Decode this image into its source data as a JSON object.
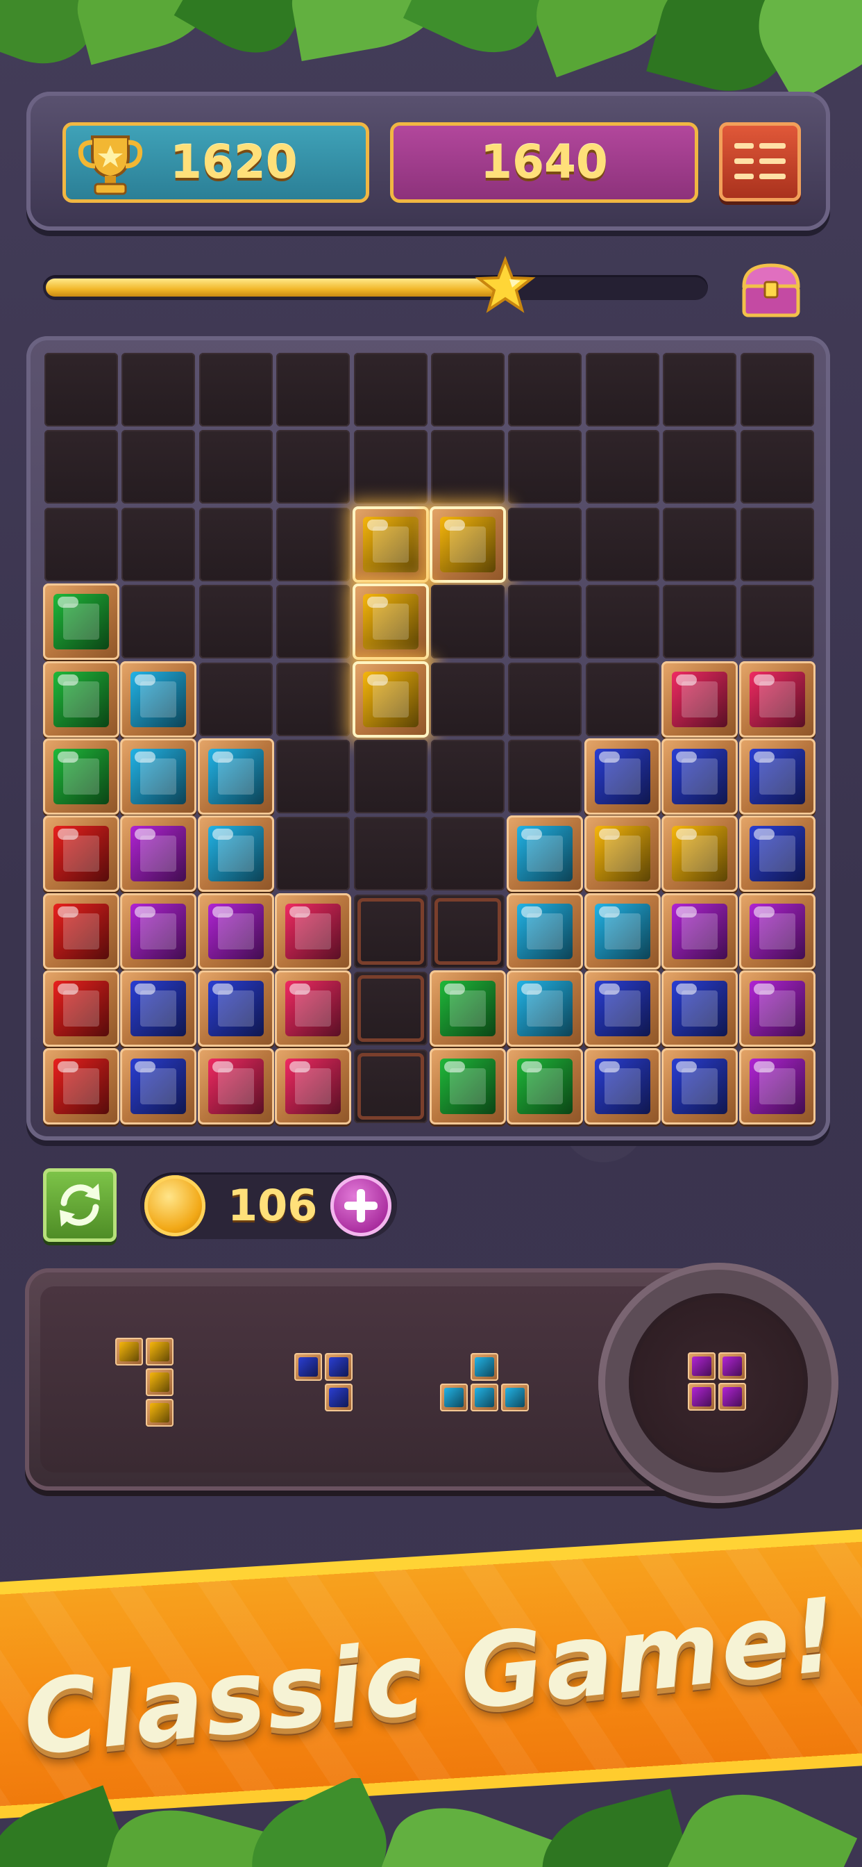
{
  "header": {
    "best_score": "1620",
    "current_score": "1640",
    "best_icon": "trophy-icon",
    "menu_icon": "menu-icon"
  },
  "progress": {
    "fraction": 0.7,
    "marker_icon": "star-icon",
    "reward_icon": "treasure-chest-icon"
  },
  "board": {
    "columns": 10,
    "rows": 10,
    "colors": {
      "G": "#1fb83a",
      "C": "#22b3e6",
      "Y": "#f6b60c",
      "R": "#e8201d",
      "P": "#b024d4",
      "B": "#2a3ed2",
      "K": "#ef2a62"
    },
    "cells": [
      "..........",
      "..........",
      "....yy....",
      "G...y.....",
      "GC..y...KK",
      "GCC....BBB",
      "RPC...CYYB",
      "RPPK..CCPP",
      "RBBK.GCBBP",
      "RBKK.GGBBP"
    ],
    "hint_cells": [
      [
        7,
        4
      ],
      [
        7,
        5
      ],
      [
        8,
        4
      ],
      [
        9,
        4
      ]
    ]
  },
  "coins": {
    "value": "106",
    "refresh_icon": "refresh-icon",
    "coin_icon": "coin-icon",
    "add_icon": "plus-icon"
  },
  "tray": {
    "pieces": [
      {
        "color": "Y",
        "shape": [
          [
            0,
            0
          ],
          [
            1,
            0
          ],
          [
            1,
            1
          ],
          [
            1,
            2
          ]
        ]
      },
      {
        "color": "B",
        "shape": [
          [
            0,
            0
          ],
          [
            1,
            0
          ],
          [
            1,
            1
          ]
        ]
      },
      {
        "color": "C",
        "shape": [
          [
            1,
            0
          ],
          [
            0,
            1
          ],
          [
            1,
            1
          ],
          [
            2,
            1
          ]
        ]
      }
    ],
    "held_piece": {
      "color": "P",
      "shape": [
        [
          0,
          0
        ],
        [
          1,
          0
        ],
        [
          0,
          1
        ],
        [
          1,
          1
        ]
      ]
    }
  },
  "banner": {
    "text": "Classic Game!"
  }
}
